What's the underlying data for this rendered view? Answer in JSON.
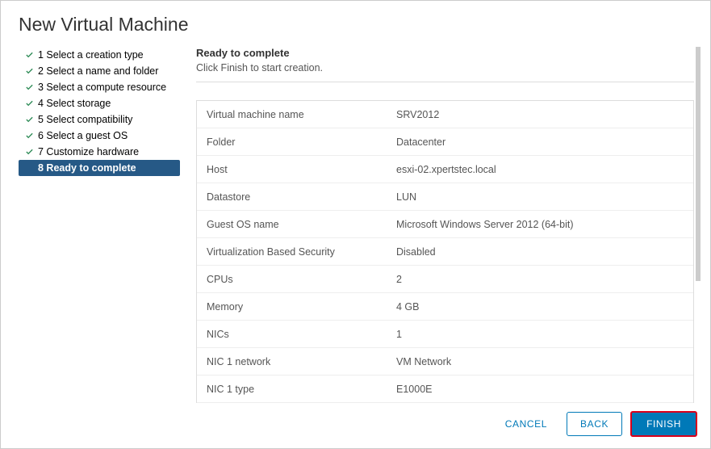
{
  "dialog": {
    "title": "New Virtual Machine"
  },
  "steps": [
    {
      "num": "1",
      "label": "Select a creation type",
      "done": true,
      "active": false
    },
    {
      "num": "2",
      "label": "Select a name and folder",
      "done": true,
      "active": false
    },
    {
      "num": "3",
      "label": "Select a compute resource",
      "done": true,
      "active": false
    },
    {
      "num": "4",
      "label": "Select storage",
      "done": true,
      "active": false
    },
    {
      "num": "5",
      "label": "Select compatibility",
      "done": true,
      "active": false
    },
    {
      "num": "6",
      "label": "Select a guest OS",
      "done": true,
      "active": false
    },
    {
      "num": "7",
      "label": "Customize hardware",
      "done": true,
      "active": false
    },
    {
      "num": "8",
      "label": "Ready to complete",
      "done": false,
      "active": true
    }
  ],
  "main": {
    "heading": "Ready to complete",
    "sub": "Click Finish to start creation."
  },
  "summary": [
    {
      "label": "Virtual machine name",
      "value": "SRV2012"
    },
    {
      "label": "Folder",
      "value": "Datacenter"
    },
    {
      "label": "Host",
      "value": "esxi-02.xpertstec.local"
    },
    {
      "label": "Datastore",
      "value": "LUN"
    },
    {
      "label": "Guest OS name",
      "value": "Microsoft Windows Server 2012 (64-bit)"
    },
    {
      "label": "Virtualization Based Security",
      "value": "Disabled"
    },
    {
      "label": "CPUs",
      "value": "2"
    },
    {
      "label": "Memory",
      "value": "4 GB"
    },
    {
      "label": "NICs",
      "value": "1"
    },
    {
      "label": "NIC 1 network",
      "value": "VM Network"
    },
    {
      "label": "NIC 1 type",
      "value": "E1000E"
    }
  ],
  "footer": {
    "cancel": "CANCEL",
    "back": "BACK",
    "finish": "FINISH"
  }
}
